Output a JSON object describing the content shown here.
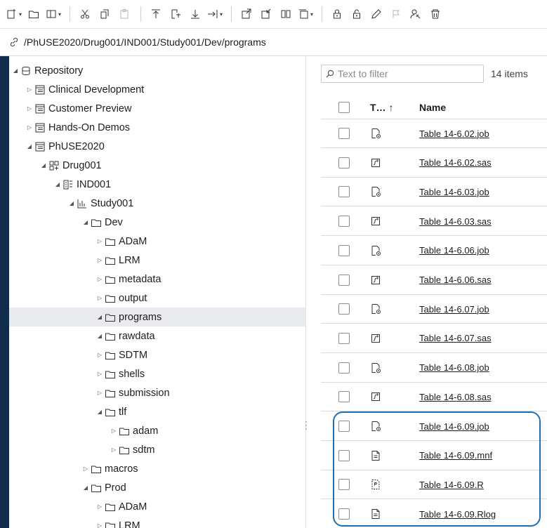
{
  "toolbar": {
    "buttons": [
      {
        "name": "new-item-icon",
        "caret": true
      },
      {
        "name": "folder-icon",
        "caret": false
      },
      {
        "name": "panel-view-icon",
        "caret": true
      },
      {
        "sep": true
      },
      {
        "name": "cut-icon",
        "caret": false
      },
      {
        "name": "copy-icon",
        "caret": false
      },
      {
        "name": "paste-icon",
        "caret": false,
        "disabled": true
      },
      {
        "sep": true
      },
      {
        "name": "upload-icon",
        "caret": false
      },
      {
        "name": "import-icon",
        "caret": false
      },
      {
        "name": "download-icon",
        "caret": false
      },
      {
        "name": "export-icon",
        "caret": true
      },
      {
        "sep": true
      },
      {
        "name": "checkout-icon",
        "caret": false
      },
      {
        "name": "checkin-icon",
        "caret": false
      },
      {
        "name": "compare-icon",
        "caret": false
      },
      {
        "name": "versions-icon",
        "caret": true
      },
      {
        "sep": true
      },
      {
        "name": "lock-icon",
        "caret": false
      },
      {
        "name": "unlock-icon",
        "caret": false
      },
      {
        "name": "edit-icon",
        "caret": false
      },
      {
        "name": "flag-icon",
        "caret": false,
        "disabled": true
      },
      {
        "name": "permissions-icon",
        "caret": false
      },
      {
        "name": "delete-icon",
        "caret": false
      }
    ]
  },
  "path": {
    "text": "/PhUSE2020/Drug001/IND001/Study001/Dev/programs"
  },
  "tree": [
    {
      "label": "Repository",
      "level": 0,
      "expanded": true,
      "icon": "repository-icon"
    },
    {
      "label": "Clinical Development",
      "level": 1,
      "expanded": false,
      "icon": "library-icon"
    },
    {
      "label": "Customer Preview",
      "level": 1,
      "expanded": false,
      "icon": "library-icon"
    },
    {
      "label": "Hands-On Demos",
      "level": 1,
      "expanded": false,
      "icon": "library-icon"
    },
    {
      "label": "PhUSE2020",
      "level": 1,
      "expanded": true,
      "icon": "library-icon"
    },
    {
      "label": "Drug001",
      "level": 2,
      "expanded": true,
      "icon": "compound-icon"
    },
    {
      "label": "IND001",
      "level": 3,
      "expanded": true,
      "icon": "submission-icon"
    },
    {
      "label": "Study001",
      "level": 4,
      "expanded": true,
      "icon": "study-icon"
    },
    {
      "label": "Dev",
      "level": 5,
      "expanded": true,
      "icon": "folder-icon"
    },
    {
      "label": "ADaM",
      "level": 6,
      "expanded": false,
      "icon": "folder-icon"
    },
    {
      "label": "LRM",
      "level": 6,
      "expanded": false,
      "icon": "folder-icon"
    },
    {
      "label": "metadata",
      "level": 6,
      "expanded": false,
      "icon": "folder-icon"
    },
    {
      "label": "output",
      "level": 6,
      "expanded": false,
      "icon": "folder-icon"
    },
    {
      "label": "programs",
      "level": 6,
      "expanded": true,
      "icon": "folder-icon",
      "selected": true
    },
    {
      "label": "rawdata",
      "level": 6,
      "expanded": true,
      "icon": "folder-icon"
    },
    {
      "label": "SDTM",
      "level": 6,
      "expanded": false,
      "icon": "folder-icon"
    },
    {
      "label": "shells",
      "level": 6,
      "expanded": false,
      "icon": "folder-icon"
    },
    {
      "label": "submission",
      "level": 6,
      "expanded": false,
      "icon": "folder-icon"
    },
    {
      "label": "tlf",
      "level": 6,
      "expanded": true,
      "icon": "folder-icon"
    },
    {
      "label": "adam",
      "level": 7,
      "expanded": false,
      "icon": "folder-icon"
    },
    {
      "label": "sdtm",
      "level": 7,
      "expanded": false,
      "icon": "folder-icon"
    },
    {
      "label": "macros",
      "level": 5,
      "expanded": false,
      "icon": "folder-icon"
    },
    {
      "label": "Prod",
      "level": 5,
      "expanded": true,
      "icon": "folder-icon"
    },
    {
      "label": "ADaM",
      "level": 6,
      "expanded": false,
      "icon": "folder-icon"
    },
    {
      "label": "LRM",
      "level": 6,
      "expanded": false,
      "icon": "folder-icon"
    }
  ],
  "filter": {
    "placeholder": "Text to filter",
    "count": "14 items"
  },
  "list": {
    "columns": {
      "type": "T…  ↑",
      "name": "Name"
    },
    "rows": [
      {
        "type": "job-icon",
        "name": "Table 14-6.02.job"
      },
      {
        "type": "sas-icon",
        "name": "Table 14-6.02.sas"
      },
      {
        "type": "job-icon",
        "name": "Table 14-6.03.job"
      },
      {
        "type": "sas-icon",
        "name": "Table 14-6.03.sas"
      },
      {
        "type": "job-icon",
        "name": "Table 14-6.06.job"
      },
      {
        "type": "sas-icon",
        "name": "Table 14-6.06.sas"
      },
      {
        "type": "job-icon",
        "name": "Table 14-6.07.job"
      },
      {
        "type": "sas-icon",
        "name": "Table 14-6.07.sas"
      },
      {
        "type": "job-icon",
        "name": "Table 14-6.08.job"
      },
      {
        "type": "sas-icon",
        "name": "Table 14-6.08.sas"
      },
      {
        "type": "job-icon",
        "name": "Table 14-6.09.job"
      },
      {
        "type": "text-file-icon",
        "name": "Table 14-6.09.mnf"
      },
      {
        "type": "r-file-icon",
        "name": "Table 14-6.09.R"
      },
      {
        "type": "text-file-icon",
        "name": "Table 14-6.09.Rlog"
      }
    ]
  },
  "colors": {
    "background": "#0f2d4a",
    "highlight": "#1f6fb3",
    "selected_row": "#e9eaed"
  }
}
